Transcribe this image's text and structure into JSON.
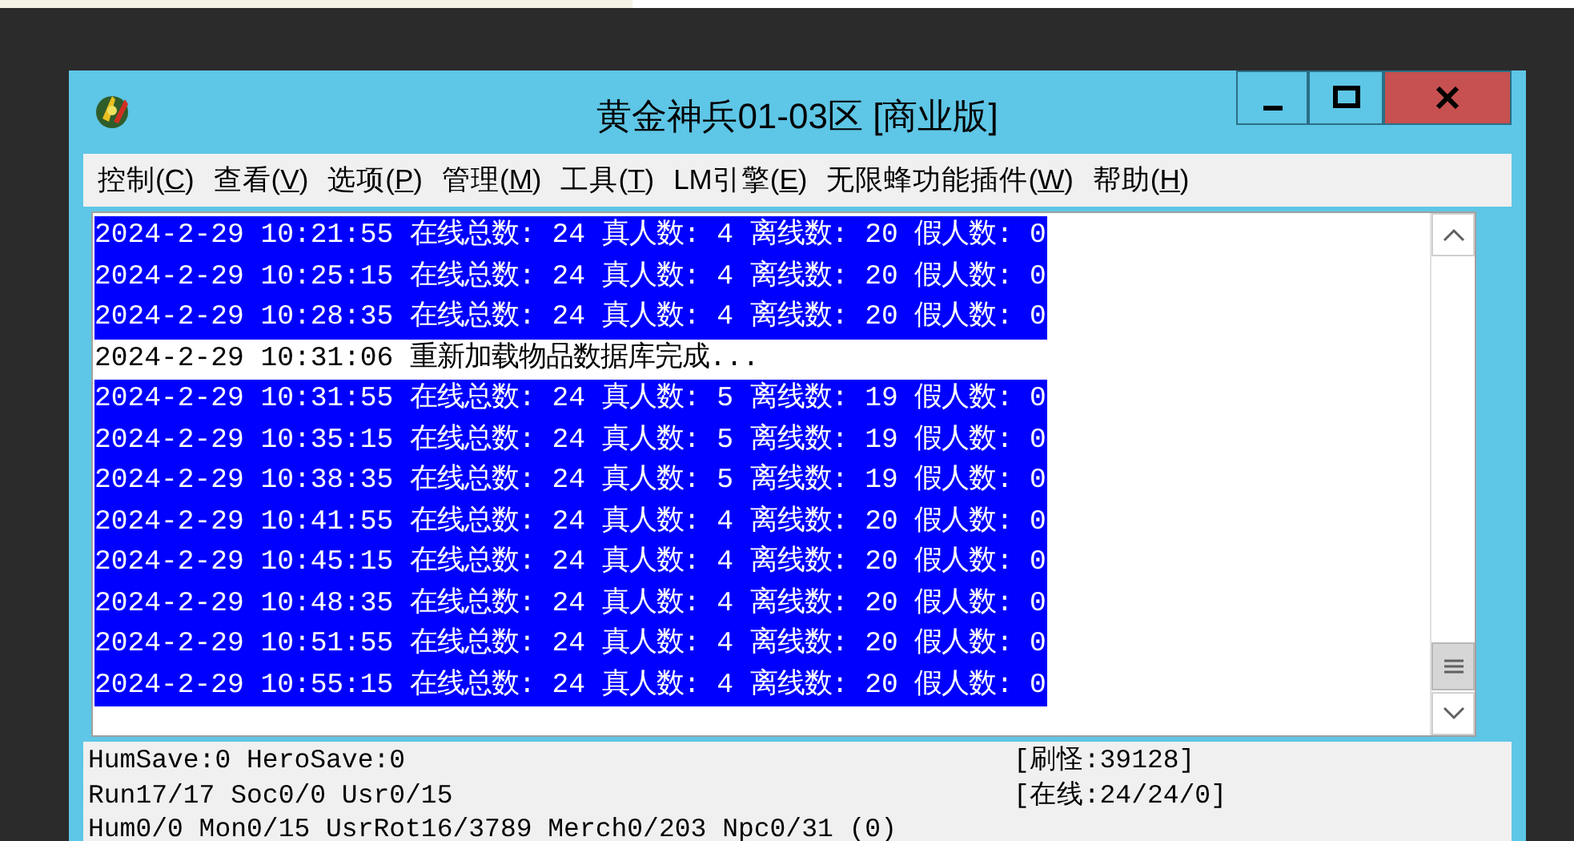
{
  "window": {
    "title": "黄金神兵01-03区 [商业版]"
  },
  "menu": [
    {
      "before": "控制(",
      "key": "C",
      "after": ")"
    },
    {
      "before": "查看(",
      "key": "V",
      "after": ")"
    },
    {
      "before": "选项(",
      "key": "P",
      "after": ")"
    },
    {
      "before": "管理(",
      "key": "M",
      "after": ")"
    },
    {
      "before": "工具(",
      "key": "T",
      "after": ")"
    },
    {
      "before": "LM引擎(",
      "key": "E",
      "after": ")"
    },
    {
      "before": "无限蜂功能插件(",
      "key": "W",
      "after": ")"
    },
    {
      "before": "帮助(",
      "key": "H",
      "after": ")"
    }
  ],
  "log_lines": [
    {
      "text": "2024-2-29 10:21:55 在线总数: 24 真人数: 4 离线数: 20 假人数: 0",
      "selected": true
    },
    {
      "text": "2024-2-29 10:25:15 在线总数: 24 真人数: 4 离线数: 20 假人数: 0",
      "selected": true
    },
    {
      "text": "2024-2-29 10:28:35 在线总数: 24 真人数: 4 离线数: 20 假人数: 0",
      "selected": true
    },
    {
      "text": "2024-2-29 10:31:06 重新加载物品数据库完成...",
      "selected": false
    },
    {
      "text": "2024-2-29 10:31:55 在线总数: 24 真人数: 5 离线数: 19 假人数: 0",
      "selected": true
    },
    {
      "text": "2024-2-29 10:35:15 在线总数: 24 真人数: 5 离线数: 19 假人数: 0",
      "selected": true
    },
    {
      "text": "2024-2-29 10:38:35 在线总数: 24 真人数: 5 离线数: 19 假人数: 0",
      "selected": true
    },
    {
      "text": "2024-2-29 10:41:55 在线总数: 24 真人数: 4 离线数: 20 假人数: 0",
      "selected": true
    },
    {
      "text": "2024-2-29 10:45:15 在线总数: 24 真人数: 4 离线数: 20 假人数: 0",
      "selected": true
    },
    {
      "text": "2024-2-29 10:48:35 在线总数: 24 真人数: 4 离线数: 20 假人数: 0",
      "selected": true
    },
    {
      "text": "2024-2-29 10:51:55 在线总数: 24 真人数: 4 离线数: 20 假人数: 0",
      "selected": true
    },
    {
      "text": "2024-2-29 10:55:15 在线总数: 24 真人数: 4 离线数: 20 假人数: 0",
      "selected": true
    }
  ],
  "status": {
    "left": [
      "HumSave:0 HeroSave:0",
      "Run17/17 Soc0/0 Usr0/15",
      "Hum0/0 Mon0/15 UsrRot16/3789 Merch0/203 Npc0/31 (0)"
    ],
    "right": [
      "[刷怪:39128]",
      "[在线:24/24/0]"
    ]
  }
}
